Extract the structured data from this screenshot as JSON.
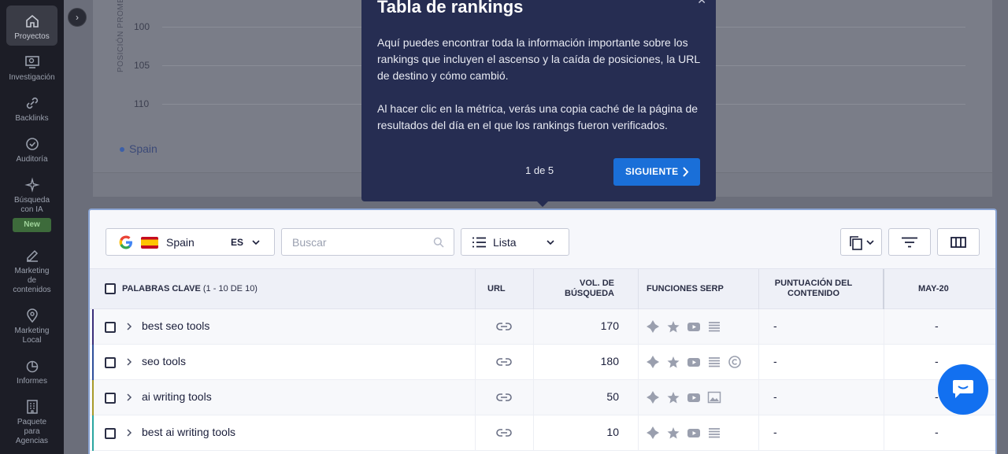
{
  "sidebar": {
    "items": [
      {
        "label": "Proyectos",
        "icon": "home-icon"
      },
      {
        "label": "Investigación",
        "icon": "monitor-search-icon"
      },
      {
        "label": "Backlinks",
        "icon": "link-icon"
      },
      {
        "label": "Auditoría",
        "icon": "check-circle-icon"
      },
      {
        "label": "Búsqueda con IA",
        "icon": "sparkle-icon"
      },
      {
        "label": "Marketing de contenidos",
        "icon": "edit-icon"
      },
      {
        "label": "Marketing Local",
        "icon": "map-pin-icon"
      },
      {
        "label": "Informes",
        "icon": "pie-chart-icon"
      },
      {
        "label": "Paquete para Agencias",
        "icon": "building-icon"
      }
    ],
    "new_badge": "New",
    "collapse_symbol": "›"
  },
  "chart": {
    "y_title": "POSICIÓN PROMEDIO",
    "y_ticks": [
      "100",
      "105",
      "110"
    ],
    "legend": "Spain"
  },
  "popup": {
    "title": "Tabla de rankings",
    "p1": "Aquí puedes encontrar toda la información importante sobre los rankings que incluyen el ascenso y la caída de posiciones, la URL de destino y cómo cambió.",
    "p2": "Al hacer clic en la métrica, verás una copia caché de la página de resultados del día en el que los rankings fueron verificados.",
    "count": "1 de 5",
    "next_label": "SIGUIENTE",
    "close_symbol": "✕"
  },
  "toolbar": {
    "country": "Spain",
    "country_code": "ES",
    "search_placeholder": "Buscar",
    "view": "Lista"
  },
  "table": {
    "headers": {
      "keywords": "PALABRAS CLAVE",
      "keywords_count": "(1 - 10 DE 10)",
      "url": "URL",
      "volume_l1": "VOL. DE",
      "volume_l2": "BÚSQUEDA",
      "serp": "FUNCIONES SERP",
      "content_l1": "PUNTUACIÓN DEL",
      "content_l2": "CONTENIDO",
      "date": "MAY-20"
    },
    "rows": [
      {
        "keyword": "best seo tools",
        "volume": "170",
        "content": "-",
        "date": "-",
        "marker": "#3b2f7a",
        "serp": [
          "featured-snippet-icon",
          "star-icon",
          "video-icon",
          "list-icon"
        ]
      },
      {
        "keyword": "seo tools",
        "volume": "180",
        "content": "-",
        "date": "-",
        "marker": "#2f4f9a",
        "serp": [
          "featured-snippet-icon",
          "star-icon",
          "video-icon",
          "list-icon",
          "copyright-icon"
        ]
      },
      {
        "keyword": "ai writing tools",
        "volume": "50",
        "content": "-",
        "date": "-",
        "marker": "#a89a2a",
        "serp": [
          "featured-snippet-icon",
          "star-icon",
          "video-icon",
          "image-icon"
        ]
      },
      {
        "keyword": "best ai writing tools",
        "volume": "10",
        "content": "-",
        "date": "-",
        "marker": "#2aa6a0",
        "serp": [
          "featured-snippet-icon",
          "star-icon",
          "video-icon",
          "list-icon"
        ]
      }
    ]
  }
}
